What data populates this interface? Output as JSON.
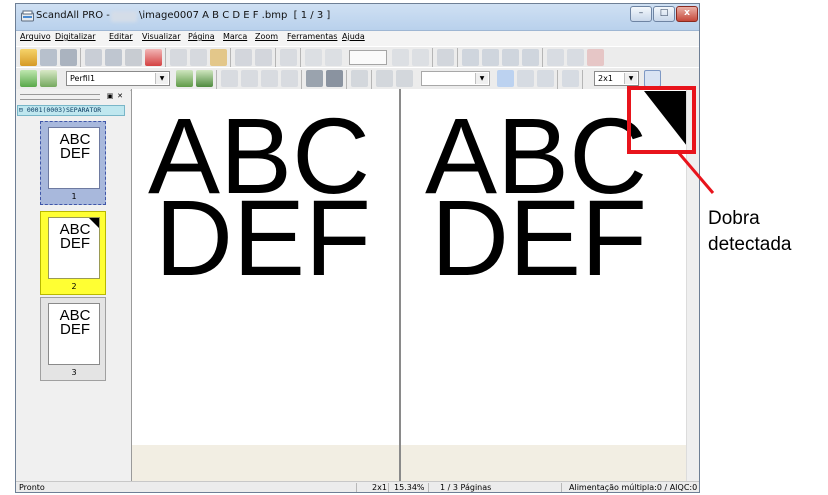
{
  "window": {
    "title_prefix": "ScandAll PRO -",
    "title_suffix": "\\image0007 A B C D E F .bmp  [ 1 / 3 ]",
    "buttons": {
      "minimize": "–",
      "maximize": "□",
      "close": "x"
    }
  },
  "menu": {
    "items": [
      "Arquivo",
      "Digitalizar",
      "Editar",
      "Visualizar",
      "Página",
      "Marca",
      "Zoom",
      "Ferramentas",
      "Ajuda"
    ]
  },
  "toolbar2": {
    "profile_value": "Perfil1",
    "empty_combo_value": "",
    "view_combo_value": "2x1"
  },
  "panel": {
    "separator_label": "0001(0003)SEPARATOR",
    "thumbnails": [
      {
        "text": "ABC\nDEF",
        "number": "1"
      },
      {
        "text": "ABC\nDEF",
        "number": "2"
      },
      {
        "text": "ABC\nDEF",
        "number": "3"
      }
    ]
  },
  "viewer": {
    "left_page": {
      "line1": "ABC",
      "line2": "DEF"
    },
    "right_page": {
      "line1": "ABC",
      "line2": "DEF"
    }
  },
  "status": {
    "ready": "Pronto",
    "view_mode": "2x1",
    "zoom": "15.34%",
    "pages": "1 / 3 Páginas",
    "feed_info": "Alimentação múltipla:0 / AIQC:0 /"
  },
  "callout": {
    "label_line1": "Dobra",
    "label_line2": "detectada",
    "color": "#e8141c"
  },
  "colors": {
    "selected_thumb": "#a8b8dc",
    "highlight_thumb": "#ffff33"
  }
}
